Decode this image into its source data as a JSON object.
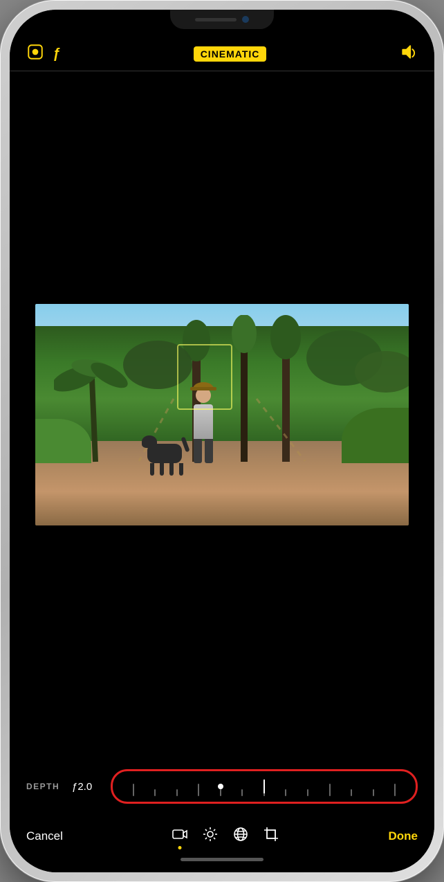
{
  "phone": {
    "notch": {
      "speaker_label": "speaker",
      "camera_label": "front-camera"
    }
  },
  "top_bar": {
    "left_icons": [
      {
        "id": "live-photo-icon",
        "symbol": "⊙",
        "label": "Live Photo"
      },
      {
        "id": "flash-icon",
        "symbol": "ƒ",
        "label": "Flash"
      }
    ],
    "mode_badge": "CINEMATIC",
    "right_icon": {
      "id": "sound-icon",
      "label": "Sound On"
    }
  },
  "video_frame": {
    "alt": "Person with dog on road with tropical trees"
  },
  "controls": {
    "depth_label": "DEPTH",
    "fstop_value": "ƒ2.0",
    "slider_aria": "Depth slider"
  },
  "toolbar": {
    "cancel_label": "Cancel",
    "done_label": "Done",
    "icons": [
      {
        "id": "cinematic-video-icon",
        "label": "Cinematic Video"
      },
      {
        "id": "adjustments-icon",
        "label": "Adjustments"
      },
      {
        "id": "globe-icon",
        "label": "Filters"
      },
      {
        "id": "crop-icon",
        "label": "Crop"
      }
    ]
  },
  "home_bar": {
    "label": "Home indicator"
  }
}
